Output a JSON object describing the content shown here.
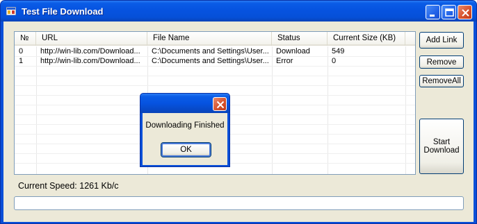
{
  "window": {
    "title": "Test File Download"
  },
  "list": {
    "columns": [
      "№",
      "URL",
      "File Name",
      "Status",
      "Current Size (KB)"
    ],
    "rows": [
      [
        "0",
        "http://win-lib.com/Download...",
        "C:\\Documents and Settings\\User...",
        "Download",
        "549"
      ],
      [
        "1",
        "http://win-lib.com/Download...",
        "C:\\Documents and Settings\\User...",
        "Error",
        "0"
      ]
    ]
  },
  "buttons": {
    "add_link": "Add Link",
    "remove": "Remove",
    "remove_all": "RemoveAll",
    "start_download_line1": "Start",
    "start_download_line2": "Download"
  },
  "status": {
    "speed_text": "Current Speed: 1261 Kb/c",
    "progress_fraction": 0
  },
  "dialog": {
    "message": "Downloading Finished",
    "ok_label": "OK"
  },
  "colors": {
    "title_bar": "#0a5ce6",
    "window_bg": "#ece9d8",
    "close_button": "#d8532e"
  }
}
